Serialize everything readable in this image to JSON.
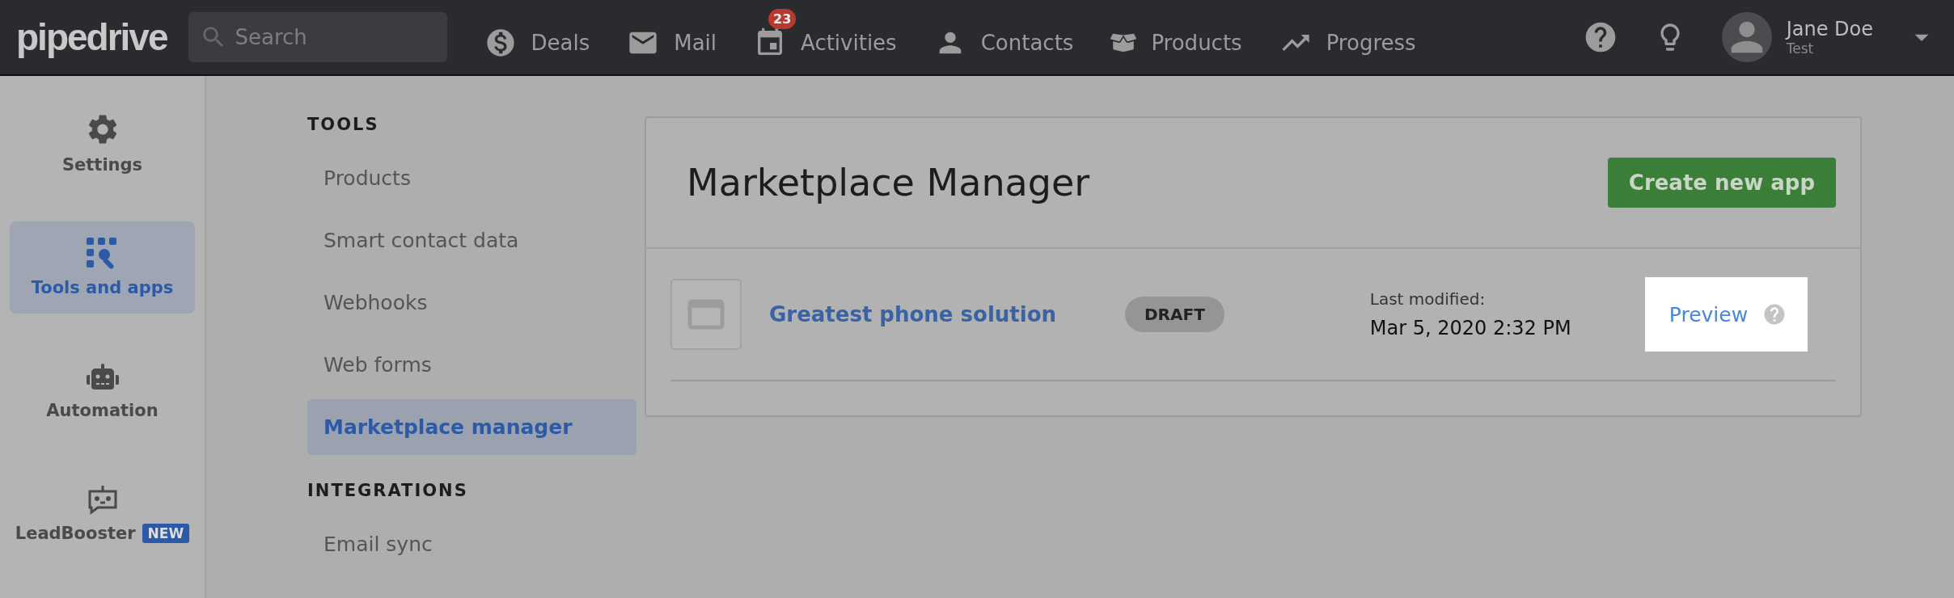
{
  "topbar": {
    "logo": "pipedrive",
    "search": {
      "placeholder": "Search"
    },
    "nav": [
      {
        "label": "Deals"
      },
      {
        "label": "Mail"
      },
      {
        "label": "Activities",
        "badge": "23"
      },
      {
        "label": "Contacts"
      },
      {
        "label": "Products"
      },
      {
        "label": "Progress"
      }
    ],
    "user": {
      "name": "Jane Doe",
      "company": "Test"
    }
  },
  "rail": [
    {
      "label": "Settings",
      "selected": false
    },
    {
      "label": "Tools and apps",
      "selected": true
    },
    {
      "label": "Automation",
      "selected": false
    },
    {
      "label": "LeadBooster",
      "selected": false,
      "badge": "NEW"
    }
  ],
  "subnav": [
    {
      "heading": "TOOLS",
      "items": [
        {
          "label": "Products",
          "selected": false
        },
        {
          "label": "Smart contact data",
          "selected": false
        },
        {
          "label": "Webhooks",
          "selected": false
        },
        {
          "label": "Web forms",
          "selected": false
        },
        {
          "label": "Marketplace manager",
          "selected": true
        }
      ]
    },
    {
      "heading": "INTEGRATIONS",
      "items": [
        {
          "label": "Email sync",
          "selected": false
        }
      ]
    }
  ],
  "card": {
    "title": "Marketplace Manager",
    "button": "Create new app",
    "apps": [
      {
        "name": "Greatest phone solution",
        "status": "DRAFT",
        "modified_label": "Last modified:",
        "modified": "Mar 5, 2020 2:32 PM",
        "action": "Preview",
        "highlighted": true
      }
    ]
  }
}
